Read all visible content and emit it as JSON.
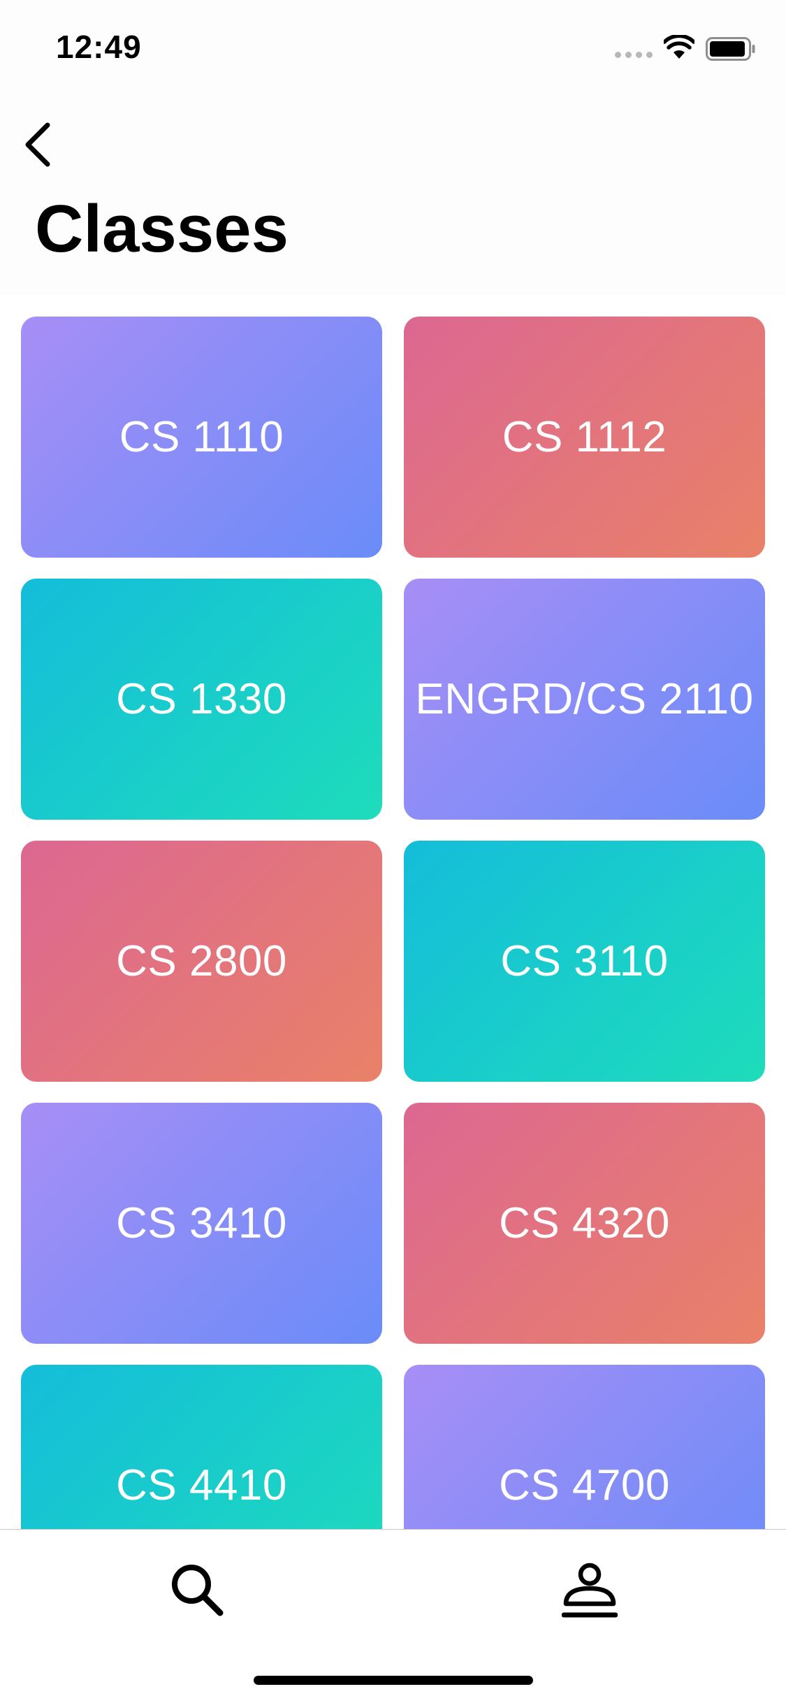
{
  "status_bar": {
    "time": "12:49"
  },
  "header": {
    "title": "Classes",
    "back_icon": "chevron-left-icon"
  },
  "classes": [
    {
      "label": "CS 1110",
      "theme": "purple"
    },
    {
      "label": "CS 1112",
      "theme": "pink"
    },
    {
      "label": "CS 1330",
      "theme": "teal"
    },
    {
      "label": "ENGRD/CS 2110",
      "theme": "purple"
    },
    {
      "label": "CS 2800",
      "theme": "pink"
    },
    {
      "label": "CS 3110",
      "theme": "teal"
    },
    {
      "label": "CS 3410",
      "theme": "purple"
    },
    {
      "label": "CS 4320",
      "theme": "pink"
    },
    {
      "label": "CS 4410",
      "theme": "teal"
    },
    {
      "label": "CS 4700",
      "theme": "purple"
    }
  ],
  "colors": {
    "purple": [
      "#a78ef6",
      "#6a8cf8"
    ],
    "pink": [
      "#dc6792",
      "#e98168"
    ],
    "teal": [
      "#14bdda",
      "#1edcbb"
    ]
  },
  "tab_bar": {
    "items": [
      {
        "icon": "search-icon"
      },
      {
        "icon": "profile-icon"
      }
    ]
  }
}
